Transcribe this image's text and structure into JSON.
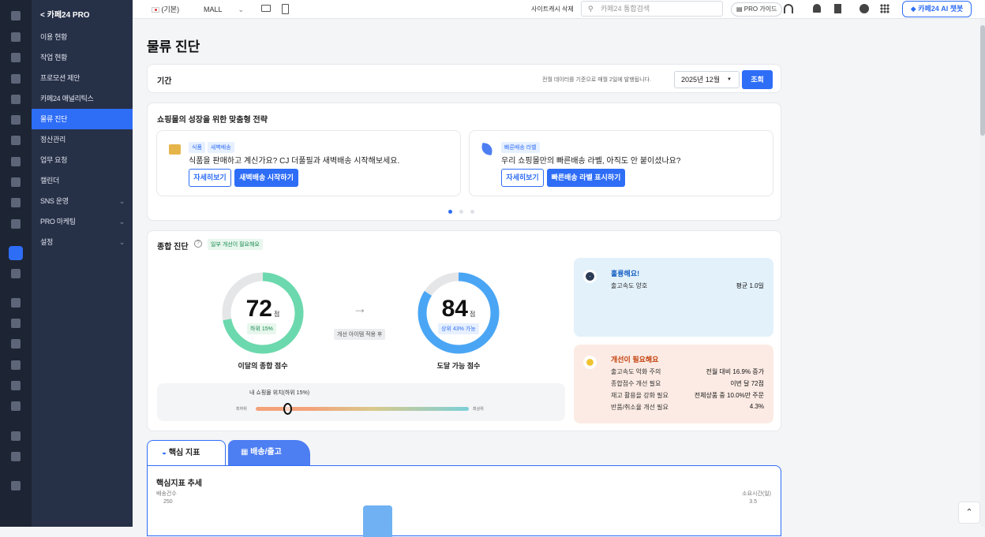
{
  "sidebar": {
    "header": "< 카페24 PRO",
    "items": [
      {
        "label": "이용 현황",
        "has_sub": false
      },
      {
        "label": "작업 현황",
        "has_sub": false
      },
      {
        "label": "프로모션 제안",
        "has_sub": false
      },
      {
        "label": "카페24 애널리틱스",
        "has_sub": false
      },
      {
        "label": "물류 진단",
        "has_sub": false,
        "active": true
      },
      {
        "label": "정산관리",
        "has_sub": false
      },
      {
        "label": "업무 요청",
        "has_sub": false
      },
      {
        "label": "캘린더",
        "has_sub": false
      },
      {
        "label": "SNS 운영",
        "has_sub": true
      },
      {
        "label": "PRO 마케팅",
        "has_sub": true
      },
      {
        "label": "설정",
        "has_sub": true
      }
    ]
  },
  "topbar": {
    "lang": "(기본)",
    "mall": "MALL",
    "cache_delete": "사이트캐시 삭제",
    "search_placeholder": "카페24 통합검색",
    "pro_guide": "PRO 가이드",
    "chatbot": "카페24 AI 챗봇"
  },
  "page": {
    "title": "물류 진단"
  },
  "period": {
    "label": "기간",
    "note": "전월 데이터를 기준으로 매월 2일에 발행됩니다.",
    "selected": "2025년 12월",
    "query_btn": "조회"
  },
  "strategy": {
    "title": "쇼핑몰의 성장을 위한 맞춤형 전략",
    "cards": [
      {
        "tags": [
          "식품",
          "새벽배송"
        ],
        "text": "식품을 판매하고 계신가요? CJ 더풀필과 새벽배송 시작해보세요.",
        "btn_detail": "자세히보기",
        "btn_action": "새벽배송 시작하기"
      },
      {
        "tags": [
          "빠른배송 라벨"
        ],
        "text": "우리 쇼핑몰만의 빠른배송 라벨, 아직도 안 붙이셨나요?",
        "btn_detail": "자세히보기",
        "btn_action": "빠른배송 라벨 표시하기"
      }
    ],
    "carousel_pages": 3,
    "carousel_active": 1
  },
  "diagnosis": {
    "title": "종합 진단",
    "badge": "일부 개선이 필요해요",
    "current": {
      "score": "72",
      "unit": "점",
      "sub": "하위 15%",
      "label": "이달의 종합 점수",
      "fraction": 0.72,
      "color": "#6bd9ad"
    },
    "arrow_note": "개선 아이템 적용 후",
    "target": {
      "score": "84",
      "unit": "점",
      "sub": "상위 43% 가능",
      "label": "도달 가능 점수",
      "fraction": 0.84,
      "color": "#4aa6f5"
    },
    "position": {
      "title": "내 쇼핑몰 위치(하위 15%)",
      "low": "최하위",
      "high": "최상위",
      "fraction": 0.15
    },
    "good": {
      "title": "훌륭해요!",
      "rows": [
        {
          "k": "출고속도 양호",
          "v": "평균 1.0일"
        }
      ]
    },
    "bad": {
      "title": "개선이 필요해요",
      "rows": [
        {
          "k": "출고속도 악화 주의",
          "v": "전월 대비 16.9% 증가"
        },
        {
          "k": "종합점수 개선 필요",
          "v": "이번 달 72점"
        },
        {
          "k": "재고 활용을 강화 필요",
          "v": "전체상품 중 10.0%만 주문"
        },
        {
          "k": "반품/취소율 개선 필요",
          "v": "4.3%"
        }
      ]
    }
  },
  "tabs": [
    {
      "label": "핵심 지표",
      "active": true
    },
    {
      "label": "배송/출고",
      "active": false
    }
  ],
  "trend": {
    "title": "핵심지표 추세",
    "left_axis": "배송건수",
    "left_max": "250",
    "right_axis": "소요시간(일)",
    "right_max": "3.5"
  }
}
